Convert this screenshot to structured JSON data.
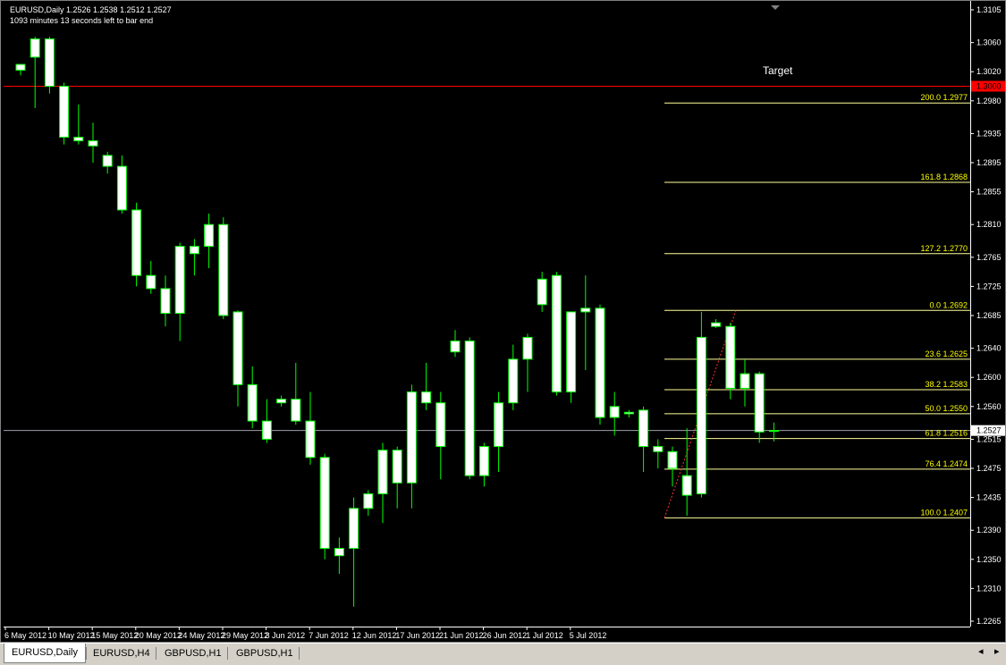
{
  "header": {
    "symbol_line": "EURUSD,Daily  1.2526 1.2538 1.2512 1.2527",
    "countdown": "1093 minutes 13 seconds left to bar end"
  },
  "annotation_text": "Target",
  "colors": {
    "background": "#000000",
    "candle_body": "#ffffff",
    "wick": "#00ff00",
    "fib_line": "#ffff99",
    "fib_label": "#ffff00",
    "target_line": "#ff0000",
    "bid_line": "#a0a0b0",
    "axis": "#ffffff"
  },
  "tabs": [
    {
      "label": "EURUSD,Daily",
      "active": true
    },
    {
      "label": "EURUSD,H4",
      "active": false
    },
    {
      "label": "GBPUSD,H1",
      "active": false
    },
    {
      "label": "GBPUSD,H1",
      "active": false
    }
  ],
  "tab_nav": {
    "left": "◂",
    "right": "▸"
  },
  "chart_data": {
    "type": "candlestick",
    "y_ticks": [
      "1.3105",
      "1.3060",
      "1.3020",
      "1.2980",
      "1.2935",
      "1.2895",
      "1.2855",
      "1.2810",
      "1.2765",
      "1.2725",
      "1.2685",
      "1.2640",
      "1.2600",
      "1.2560",
      "1.2515",
      "1.2475",
      "1.2435",
      "1.2390",
      "1.2350",
      "1.2310",
      "1.2265"
    ],
    "ylim": [
      1.2265,
      1.3105
    ],
    "x_labels": [
      "6 May 2012",
      "10 May 2012",
      "15 May 2012",
      "20 May 2012",
      "24 May 2012",
      "29 May 2012",
      "3 Jun 2012",
      "7 Jun 2012",
      "12 Jun 2012",
      "17 Jun 2012",
      "21 Jun 2012",
      "26 Jun 2012",
      "1 Jul 2012",
      "5 Jul 2012"
    ],
    "target_level": {
      "value": 1.3,
      "label": "1.3000"
    },
    "current_price": {
      "value": 1.2527,
      "label": "1.2527"
    },
    "fibonacci": {
      "levels": [
        {
          "label": "200.0 1.2977",
          "value": 1.2977
        },
        {
          "label": "161.8 1.2868",
          "value": 1.2868
        },
        {
          "label": "127.2 1.2770",
          "value": 1.277
        },
        {
          "label": "0.0 1.2692",
          "value": 1.2692
        },
        {
          "label": "23.6 1.2625",
          "value": 1.2625
        },
        {
          "label": "38.2 1.2583",
          "value": 1.2583
        },
        {
          "label": "50.0 1.2550",
          "value": 1.255
        },
        {
          "label": "61.8 1.2516",
          "value": 1.2516
        },
        {
          "label": "76.4 1.2474",
          "value": 1.2474
        },
        {
          "label": "100.0 1.2407",
          "value": 1.2407
        }
      ],
      "trend_from": 1.2407,
      "trend_to": 1.2692
    },
    "candles": [
      {
        "o": 1.303,
        "h": 1.303,
        "l": 1.3015,
        "c": 1.3022
      },
      {
        "o": 1.304,
        "h": 1.3068,
        "l": 1.297,
        "c": 1.3065
      },
      {
        "o": 1.3,
        "h": 1.3068,
        "l": 1.299,
        "c": 1.3065
      },
      {
        "o": 1.3,
        "h": 1.3005,
        "l": 1.292,
        "c": 1.293
      },
      {
        "o": 1.293,
        "h": 1.2975,
        "l": 1.292,
        "c": 1.2925
      },
      {
        "o": 1.2925,
        "h": 1.295,
        "l": 1.2895,
        "c": 1.2918
      },
      {
        "o": 1.2905,
        "h": 1.291,
        "l": 1.288,
        "c": 1.289
      },
      {
        "o": 1.289,
        "h": 1.2905,
        "l": 1.2825,
        "c": 1.283
      },
      {
        "o": 1.283,
        "h": 1.284,
        "l": 1.2725,
        "c": 1.274
      },
      {
        "o": 1.274,
        "h": 1.276,
        "l": 1.2715,
        "c": 1.2722
      },
      {
        "o": 1.2722,
        "h": 1.274,
        "l": 1.267,
        "c": 1.2688
      },
      {
        "o": 1.2688,
        "h": 1.2785,
        "l": 1.265,
        "c": 1.278
      },
      {
        "o": 1.277,
        "h": 1.279,
        "l": 1.274,
        "c": 1.278
      },
      {
        "o": 1.278,
        "h": 1.2825,
        "l": 1.275,
        "c": 1.281
      },
      {
        "o": 1.281,
        "h": 1.282,
        "l": 1.268,
        "c": 1.2685
      },
      {
        "o": 1.269,
        "h": 1.2692,
        "l": 1.256,
        "c": 1.259
      },
      {
        "o": 1.259,
        "h": 1.2615,
        "l": 1.253,
        "c": 1.254
      },
      {
        "o": 1.254,
        "h": 1.257,
        "l": 1.251,
        "c": 1.2515
      },
      {
        "o": 1.257,
        "h": 1.2575,
        "l": 1.256,
        "c": 1.2565
      },
      {
        "o": 1.257,
        "h": 1.262,
        "l": 1.2535,
        "c": 1.254
      },
      {
        "o": 1.254,
        "h": 1.258,
        "l": 1.248,
        "c": 1.249
      },
      {
        "o": 1.249,
        "h": 1.2495,
        "l": 1.235,
        "c": 1.2365
      },
      {
        "o": 1.2365,
        "h": 1.238,
        "l": 1.233,
        "c": 1.2355
      },
      {
        "o": 1.2365,
        "h": 1.2435,
        "l": 1.2285,
        "c": 1.242
      },
      {
        "o": 1.242,
        "h": 1.2445,
        "l": 1.241,
        "c": 1.244
      },
      {
        "o": 1.244,
        "h": 1.251,
        "l": 1.24,
        "c": 1.25
      },
      {
        "o": 1.25,
        "h": 1.2505,
        "l": 1.242,
        "c": 1.2455
      },
      {
        "o": 1.2455,
        "h": 1.259,
        "l": 1.242,
        "c": 1.258
      },
      {
        "o": 1.258,
        "h": 1.262,
        "l": 1.2555,
        "c": 1.2565
      },
      {
        "o": 1.2565,
        "h": 1.258,
        "l": 1.246,
        "c": 1.2505
      },
      {
        "o": 1.2635,
        "h": 1.2665,
        "l": 1.2628,
        "c": 1.265
      },
      {
        "o": 1.265,
        "h": 1.2655,
        "l": 1.246,
        "c": 1.2465
      },
      {
        "o": 1.2465,
        "h": 1.251,
        "l": 1.245,
        "c": 1.2505
      },
      {
        "o": 1.2505,
        "h": 1.258,
        "l": 1.247,
        "c": 1.2565
      },
      {
        "o": 1.2565,
        "h": 1.2645,
        "l": 1.2555,
        "c": 1.2625
      },
      {
        "o": 1.2625,
        "h": 1.266,
        "l": 1.258,
        "c": 1.2655
      },
      {
        "o": 1.27,
        "h": 1.2745,
        "l": 1.269,
        "c": 1.2735
      },
      {
        "o": 1.274,
        "h": 1.2745,
        "l": 1.2575,
        "c": 1.258
      },
      {
        "o": 1.258,
        "h": 1.269,
        "l": 1.2565,
        "c": 1.269
      },
      {
        "o": 1.269,
        "h": 1.274,
        "l": 1.261,
        "c": 1.2695
      },
      {
        "o": 1.2695,
        "h": 1.27,
        "l": 1.2535,
        "c": 1.2545
      },
      {
        "o": 1.2545,
        "h": 1.258,
        "l": 1.252,
        "c": 1.256
      },
      {
        "o": 1.255,
        "h": 1.2555,
        "l": 1.2545,
        "c": 1.2552
      },
      {
        "o": 1.2555,
        "h": 1.256,
        "l": 1.247,
        "c": 1.2505
      },
      {
        "o": 1.2505,
        "h": 1.2515,
        "l": 1.2475,
        "c": 1.2498
      },
      {
        "o": 1.2498,
        "h": 1.2505,
        "l": 1.245,
        "c": 1.2475
      },
      {
        "o": 1.2465,
        "h": 1.253,
        "l": 1.241,
        "c": 1.2438
      },
      {
        "o": 1.244,
        "h": 1.269,
        "l": 1.2435,
        "c": 1.2655
      },
      {
        "o": 1.2675,
        "h": 1.268,
        "l": 1.2668,
        "c": 1.267
      },
      {
        "o": 1.267,
        "h": 1.2675,
        "l": 1.257,
        "c": 1.2585
      },
      {
        "o": 1.2585,
        "h": 1.2625,
        "l": 1.256,
        "c": 1.2605
      },
      {
        "o": 1.2605,
        "h": 1.2608,
        "l": 1.251,
        "c": 1.2525
      },
      {
        "o": 1.2526,
        "h": 1.2538,
        "l": 1.2512,
        "c": 1.2527
      }
    ]
  }
}
